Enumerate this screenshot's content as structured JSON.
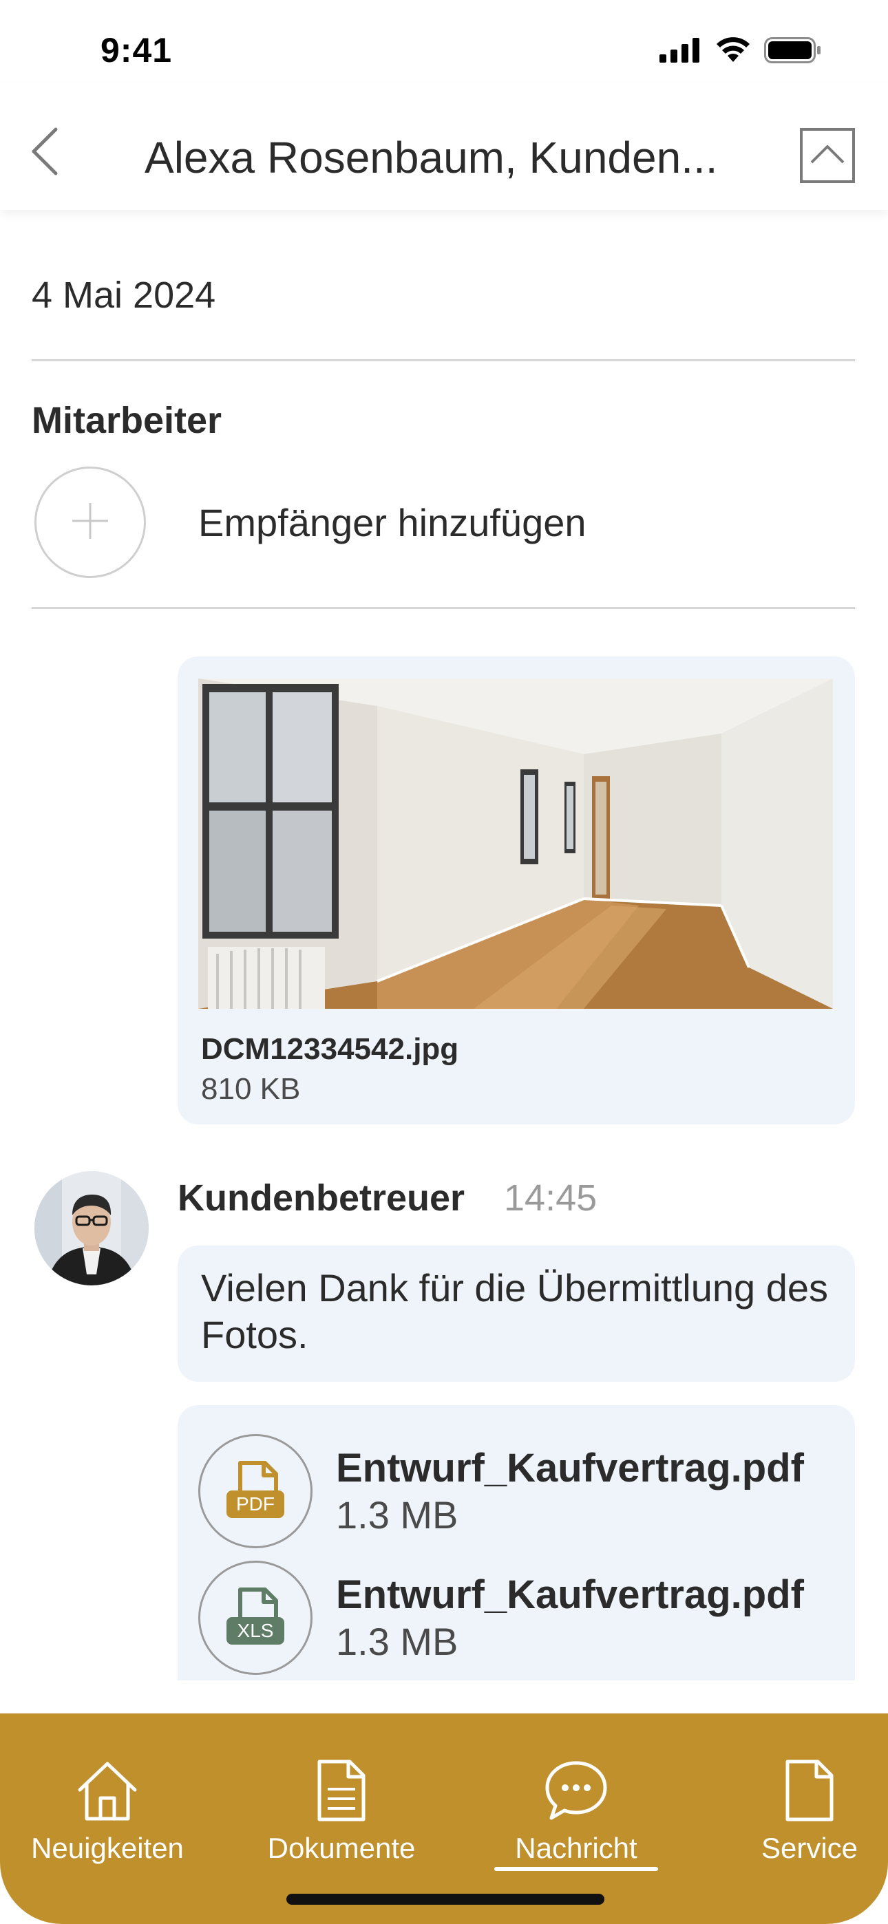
{
  "status_bar": {
    "time": "9:41",
    "icons": [
      "signal-icon",
      "wifi-icon",
      "battery-icon"
    ]
  },
  "header": {
    "title": "Alexa Rosenbaum, Kunden...",
    "back_icon": "chevron-left-icon",
    "collapse_icon": "chevron-up-icon"
  },
  "conversation": {
    "date": "4 Mai 2024",
    "section_title": "Mitarbeiter",
    "add_recipient_label": "Empfänger hinzufügen"
  },
  "messages": {
    "photo": {
      "filename": "DCM12334542.jpg",
      "size": "810 KB"
    },
    "sender": {
      "name": "Kundenbetreuer",
      "time": "14:45"
    },
    "text": "Vielen Dank für die Übermittlung des Fotos.",
    "files": [
      {
        "name": "Entwurf_Kaufvertrag.pdf",
        "size": "1.3 MB",
        "type_label": "PDF",
        "icon": "pdf-file-icon",
        "color": "#bf902c"
      },
      {
        "name": "Entwurf_Kaufvertrag.pdf",
        "size": "1.3 MB",
        "type_label": "XLS",
        "icon": "xls-file-icon",
        "color": "#5f7d66"
      }
    ]
  },
  "tab_bar": {
    "background": "#bf902c",
    "active_index": 2,
    "tabs": [
      {
        "label": "Neuigkeiten",
        "icon": "home-icon"
      },
      {
        "label": "Dokumente",
        "icon": "document-icon"
      },
      {
        "label": "Nachricht",
        "icon": "chat-icon"
      },
      {
        "label": "Service",
        "icon": "page-icon"
      }
    ]
  }
}
